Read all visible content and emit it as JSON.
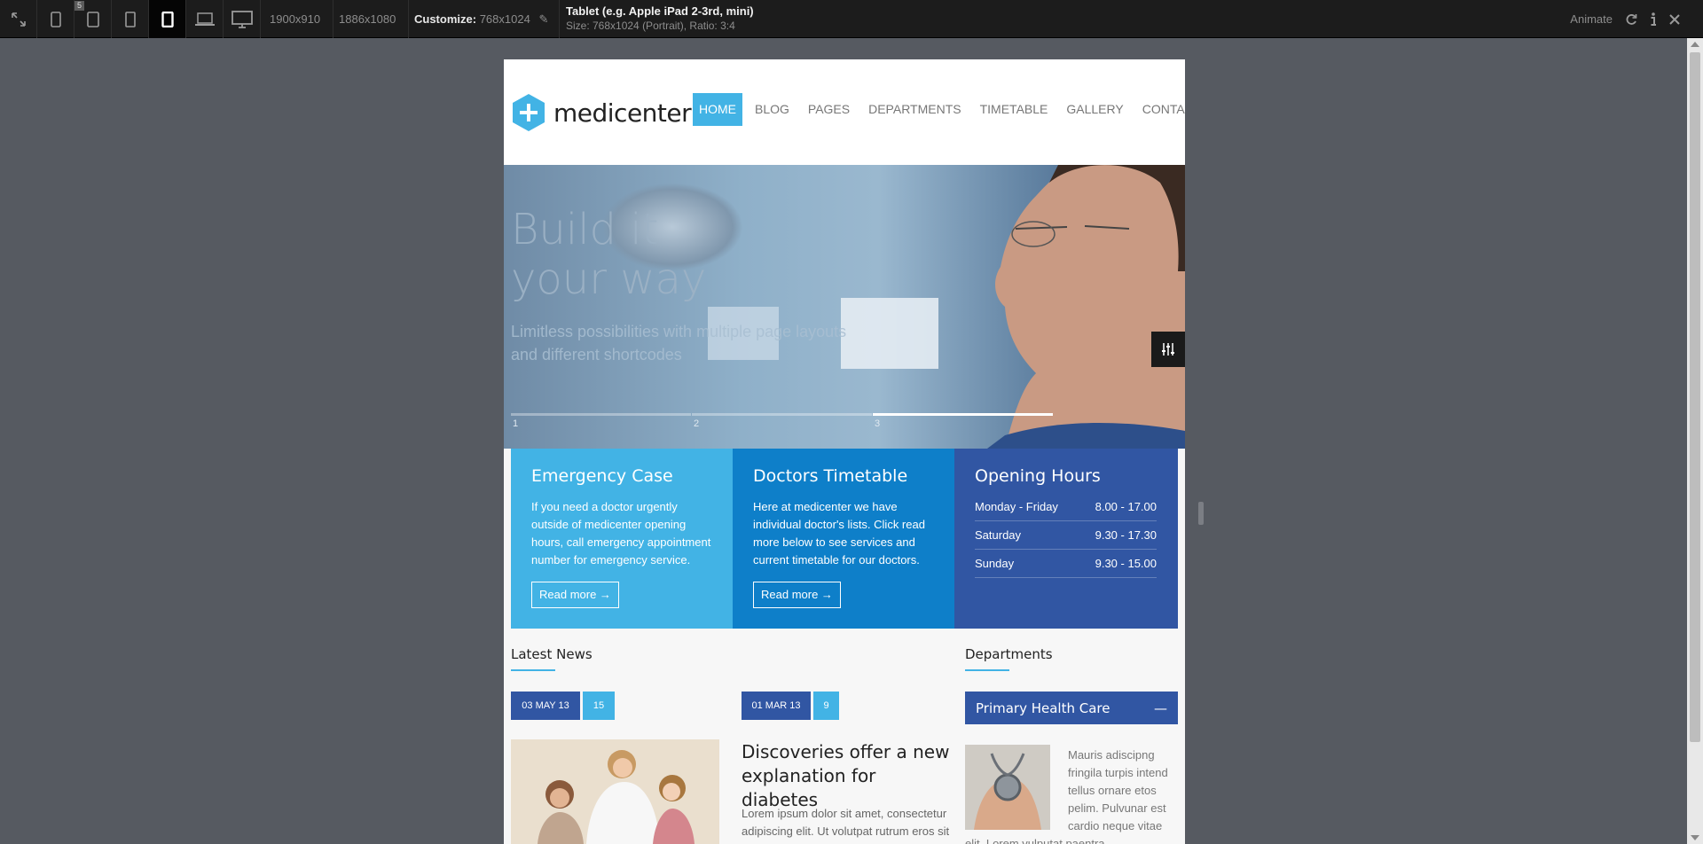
{
  "toolbar": {
    "badge": "5",
    "res1": "1900x910",
    "res2": "1886x1080",
    "customize_label": "Customize:",
    "customize_value": "768x1024",
    "device_title": "Tablet (e.g. Apple iPad 2-3rd, mini)",
    "device_sub": "Size: 768x1024 (Portrait), Ratio: 3:4",
    "animate": "Animate"
  },
  "site": {
    "logo": "medicenter",
    "nav": [
      "HOME",
      "BLOG",
      "PAGES",
      "DEPARTMENTS",
      "TIMETABLE",
      "GALLERY",
      "CONTACT"
    ],
    "hero": {
      "title_line1": "Build it",
      "title_line2": "your way",
      "subtitle": "Limitless possibilities with multiple page layouts and different shortcodes",
      "slides": [
        "1",
        "2",
        "3"
      ]
    },
    "features": {
      "emergency": {
        "title": "Emergency Case",
        "text": "If you need a doctor urgently outside of medicenter opening hours, call emergency appointment number for emergency service.",
        "button": "Read more →"
      },
      "timetable": {
        "title": "Doctors Timetable",
        "text": "Here at medicenter we have individual doctor's lists. Click read more below to see services and current timetable for our doctors.",
        "button": "Read more →"
      },
      "hours": {
        "title": "Opening Hours",
        "rows": [
          {
            "day": "Monday - Friday",
            "time": "8.00 - 17.00"
          },
          {
            "day": "Saturday",
            "time": "9.30 - 17.30"
          },
          {
            "day": "Sunday",
            "time": "9.30 - 15.00"
          }
        ]
      }
    },
    "latest_news": {
      "title": "Latest News",
      "items": [
        {
          "date": "03 MAY 13",
          "comments": "15"
        },
        {
          "date": "01 MAR 13",
          "comments": "9",
          "title": "Discoveries offer a new explanation for diabetes",
          "text": "Lorem ipsum dolor sit amet, consectetur adipiscing elit. Ut volutpat rutrum eros sit amet mollis. Cras pulvinar"
        }
      ]
    },
    "departments": {
      "title": "Departments",
      "item": "Primary Health Care",
      "toggle": "—",
      "text": "Mauris adiscipng fringila turpis intend tellus ornare etos pelim. Pulvunar est cardio neque vitae elit. Lorem vulputat paentra"
    }
  },
  "colors": {
    "accent": "#42b3e5",
    "emergency": "#42b3e5",
    "timetable": "#0e7fc9",
    "hours": "#3156a3",
    "date_badge": "#3156a3"
  }
}
